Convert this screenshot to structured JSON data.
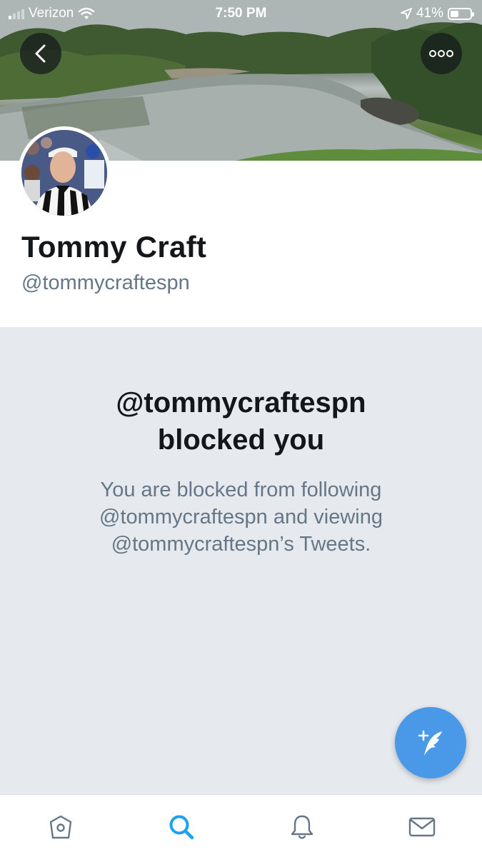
{
  "status_bar": {
    "carrier": "Verizon",
    "time": "7:50 PM",
    "battery": "41%",
    "battery_level": 0.41
  },
  "profile": {
    "name": "Tommy Craft",
    "handle": "@tommycraftespn"
  },
  "blocked": {
    "title_line1": "@tommycraftespn",
    "title_line2": "blocked you",
    "description_line1": "You are blocked from following",
    "description_line2": "@tommycraftespn and viewing",
    "description_line3": "@tommycraftespn’s Tweets."
  },
  "header_buttons": {
    "back_icon": "chevron-left-icon",
    "more_icon": "more-horizontal-icon"
  },
  "fab": {
    "icon": "compose-tweet-icon"
  },
  "tab_bar": {
    "items": [
      {
        "name": "home",
        "icon": "home-icon",
        "active": false
      },
      {
        "name": "search",
        "icon": "search-icon",
        "active": true
      },
      {
        "name": "notifications",
        "icon": "bell-icon",
        "active": false
      },
      {
        "name": "messages",
        "icon": "mail-icon",
        "active": false
      }
    ]
  },
  "colors": {
    "accent": "#1da1f2",
    "fab": "#4a99e9",
    "panel_bg": "#e6e9ee",
    "text_primary": "#14171a",
    "text_secondary": "#657786",
    "icon_inactive": "#657786"
  }
}
